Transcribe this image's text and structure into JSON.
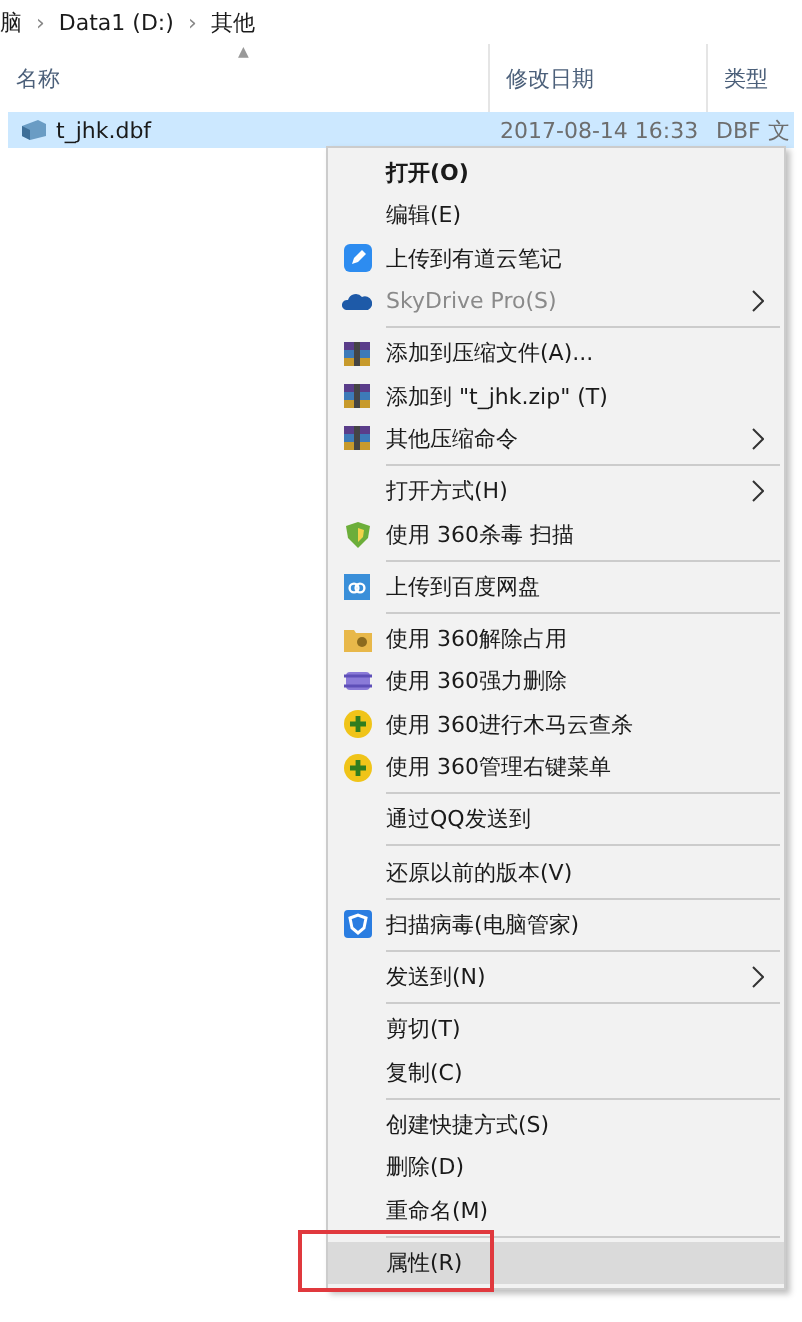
{
  "breadcrumb": [
    "脑",
    "›",
    "Data1 (D:)",
    "›",
    "其他"
  ],
  "columns": [
    {
      "label": "名称",
      "sort": "▲"
    },
    {
      "label": "修改日期"
    },
    {
      "label": "类型"
    }
  ],
  "file": {
    "name": "t_jhk.dbf",
    "date": "2017-08-14 16:33",
    "type": "DBF 文",
    "selected": true
  },
  "menu": [
    {
      "kind": "item",
      "label": "打开(O)",
      "bold": true,
      "selected": false
    },
    {
      "kind": "item",
      "label": "编辑(E)",
      "selected": false
    },
    {
      "kind": "item",
      "label": "上传到有道云笔记",
      "selected": false
    },
    {
      "kind": "item",
      "label": "SkyDrive Pro(S)",
      "disabled": true,
      "submenu": true,
      "selected": false
    },
    {
      "kind": "separator"
    },
    {
      "kind": "item",
      "label": "添加到压缩文件(A)...",
      "selected": false
    },
    {
      "kind": "item",
      "label": "添加到 \"t_jhk.zip\" (T)",
      "selected": false
    },
    {
      "kind": "item",
      "label": "其他压缩命令",
      "submenu": true,
      "selected": false
    },
    {
      "kind": "separator"
    },
    {
      "kind": "item",
      "label": "打开方式(H)",
      "submenu": true,
      "selected": false
    },
    {
      "kind": "item",
      "label": "使用 360杀毒 扫描",
      "selected": false
    },
    {
      "kind": "separator"
    },
    {
      "kind": "item",
      "label": "上传到百度网盘",
      "selected": false
    },
    {
      "kind": "separator"
    },
    {
      "kind": "item",
      "label": "使用 360解除占用",
      "selected": false
    },
    {
      "kind": "item",
      "label": "使用 360强力删除",
      "selected": false
    },
    {
      "kind": "item",
      "label": "使用 360进行木马云查杀",
      "selected": false
    },
    {
      "kind": "item",
      "label": "使用 360管理右键菜单",
      "selected": false
    },
    {
      "kind": "separator"
    },
    {
      "kind": "item",
      "label": "通过QQ发送到",
      "selected": false
    },
    {
      "kind": "separator"
    },
    {
      "kind": "item",
      "label": "还原以前的版本(V)",
      "selected": false
    },
    {
      "kind": "separator"
    },
    {
      "kind": "item",
      "label": "扫描病毒(电脑管家)",
      "selected": false
    },
    {
      "kind": "separator"
    },
    {
      "kind": "item",
      "label": "发送到(N)",
      "submenu": true,
      "selected": false
    },
    {
      "kind": "separator"
    },
    {
      "kind": "item",
      "label": "剪切(T)",
      "selected": false
    },
    {
      "kind": "item",
      "label": "复制(C)",
      "selected": false
    },
    {
      "kind": "separator"
    },
    {
      "kind": "item",
      "label": "创建快捷方式(S)",
      "selected": false
    },
    {
      "kind": "item",
      "label": "删除(D)",
      "selected": false
    },
    {
      "kind": "item",
      "label": "重命名(M)",
      "selected": false
    },
    {
      "kind": "separator"
    },
    {
      "kind": "item",
      "label": "属性(R)",
      "selected": true,
      "annotated": true
    }
  ]
}
